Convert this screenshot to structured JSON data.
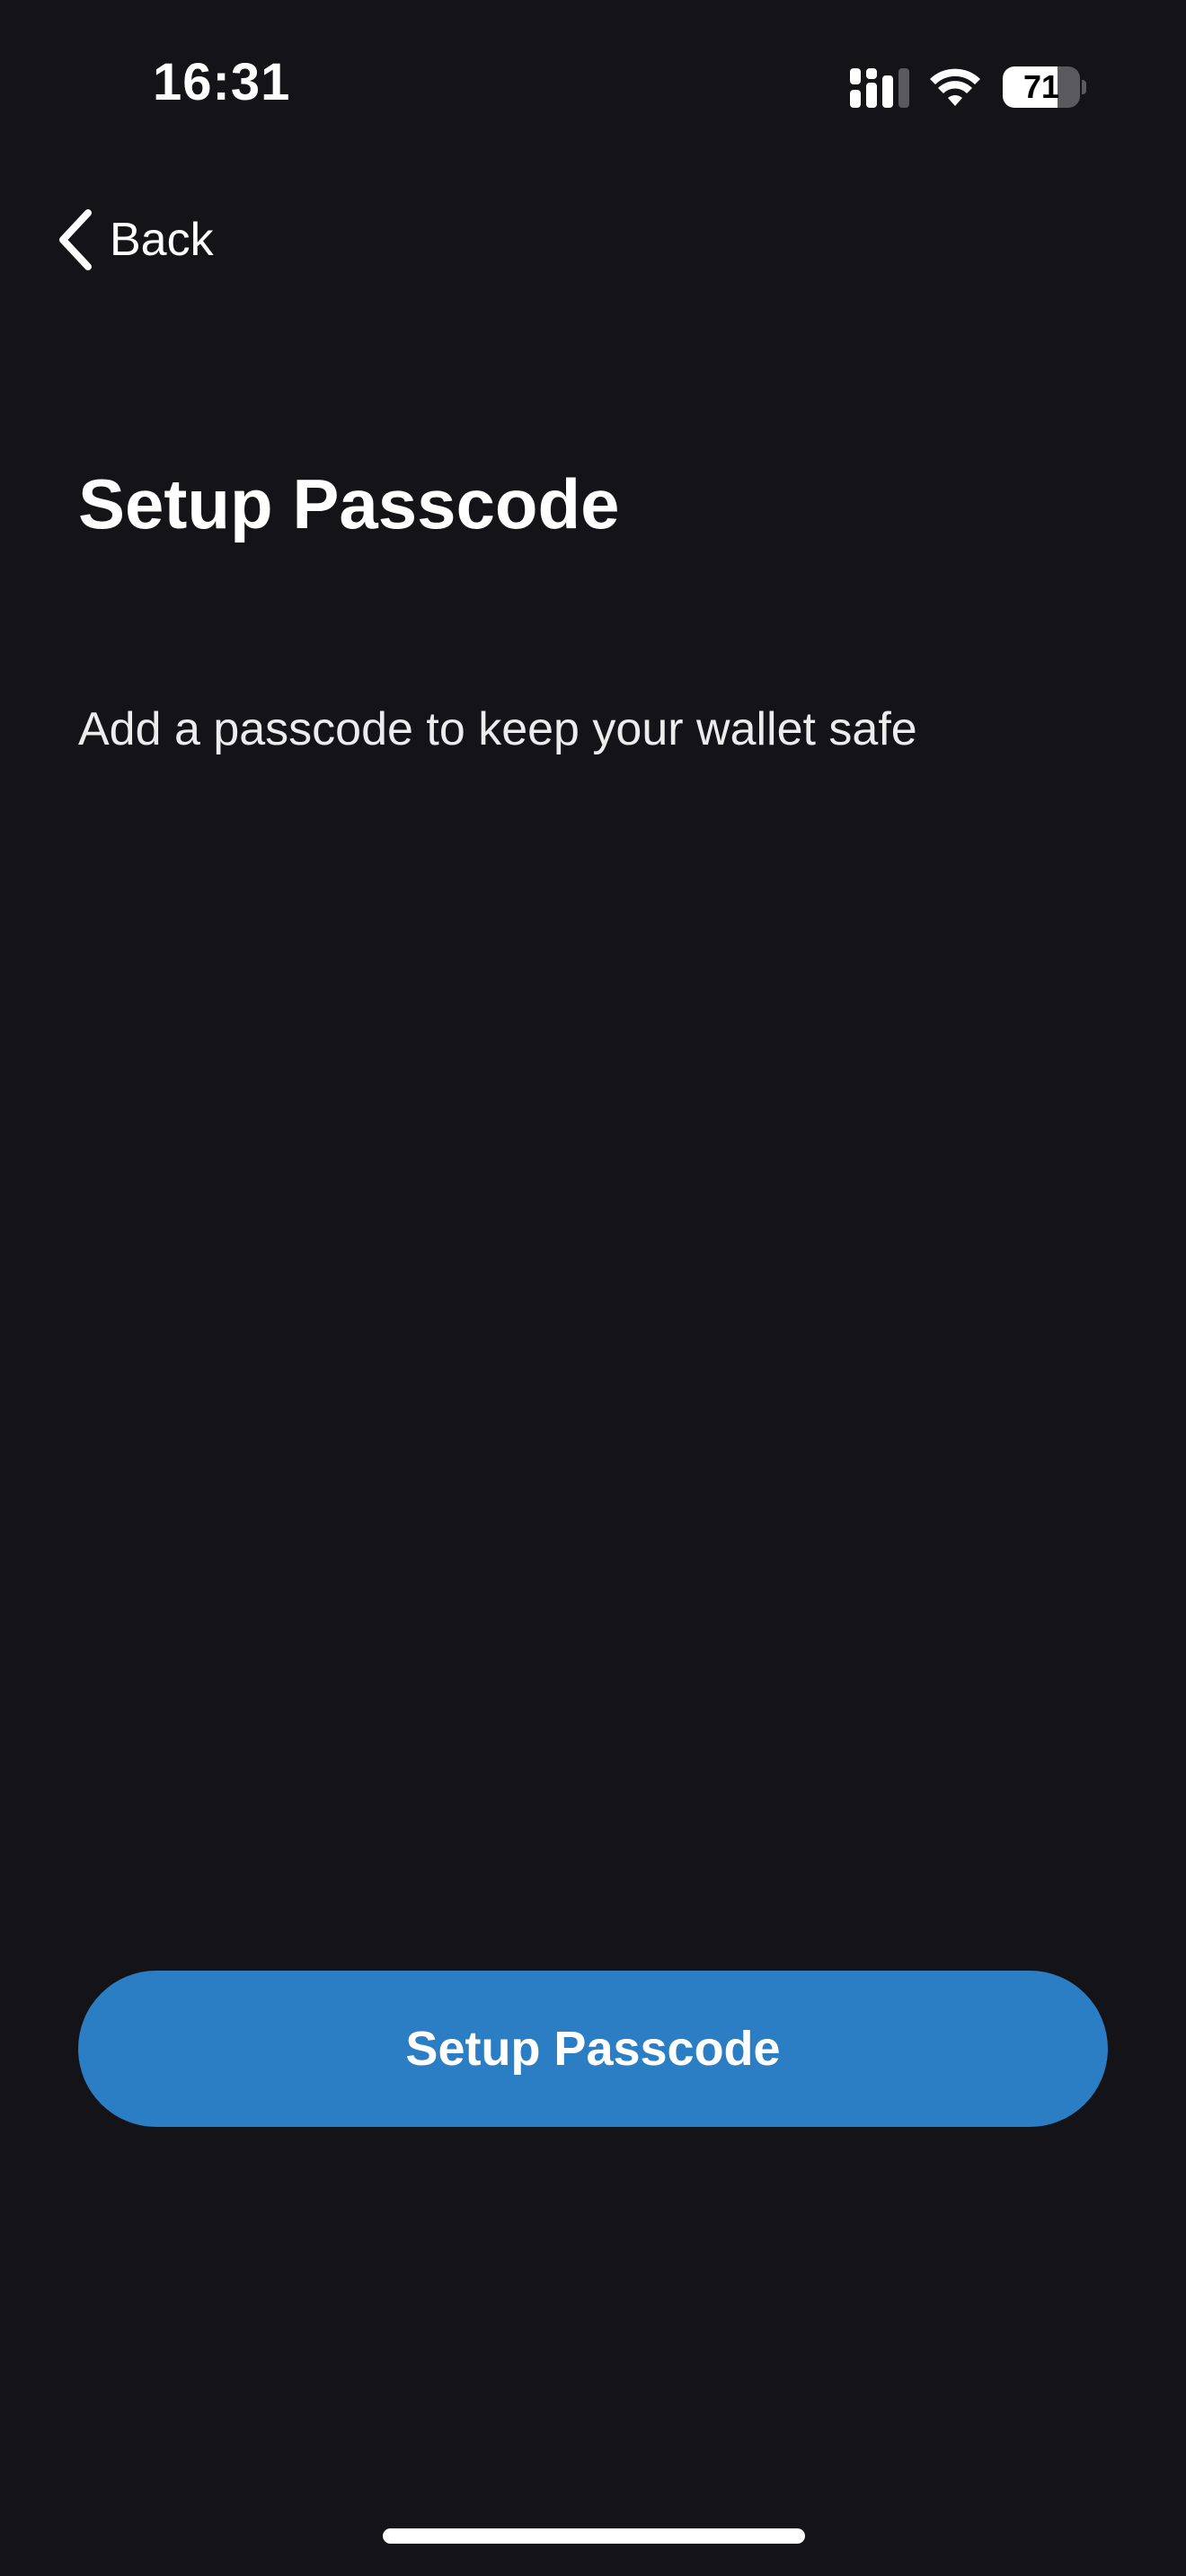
{
  "status_bar": {
    "time": "16:31",
    "signal_icon": "cellular-signal-icon",
    "wifi_icon": "wifi-icon",
    "battery_level": "71",
    "battery_fraction": 0.71
  },
  "nav": {
    "back_icon": "chevron-left-icon",
    "back_label": "Back"
  },
  "main": {
    "title": "Setup Passcode",
    "subtitle": "Add a passcode to keep your wallet safe"
  },
  "actions": {
    "primary_label": "Setup Passcode"
  },
  "colors": {
    "background": "#141418",
    "primary_button": "#2b7ec3",
    "text": "#ffffff"
  }
}
